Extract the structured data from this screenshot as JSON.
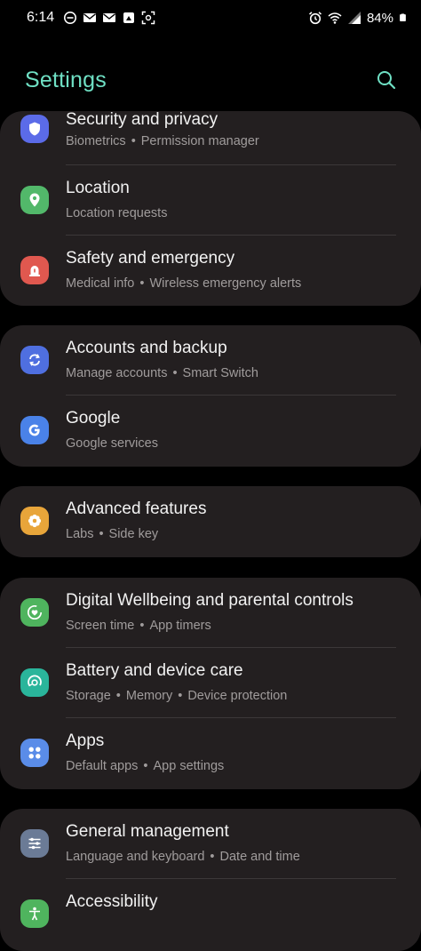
{
  "status_bar": {
    "time": "6:14",
    "battery": "84%"
  },
  "header": {
    "title": "Settings",
    "accent_color": "#6fe0c4"
  },
  "groups": [
    {
      "items": [
        {
          "title": "Security and privacy",
          "subtitle_parts": [
            "Biometrics",
            "Permission manager"
          ],
          "icon": "shield-icon",
          "color": "#5b6be8"
        },
        {
          "title": "Location",
          "subtitle_parts": [
            "Location requests"
          ],
          "icon": "location-pin-icon",
          "color": "#52b86a"
        },
        {
          "title": "Safety and emergency",
          "subtitle_parts": [
            "Medical info",
            "Wireless emergency alerts"
          ],
          "icon": "siren-icon",
          "color": "#e0584f"
        }
      ]
    },
    {
      "items": [
        {
          "title": "Accounts and backup",
          "subtitle_parts": [
            "Manage accounts",
            "Smart Switch"
          ],
          "icon": "sync-icon",
          "color": "#4f6fe0"
        },
        {
          "title": "Google",
          "subtitle_parts": [
            "Google services"
          ],
          "icon": "google-icon",
          "color": "#4a82e8"
        }
      ]
    },
    {
      "items": [
        {
          "title": "Advanced features",
          "subtitle_parts": [
            "Labs",
            "Side key"
          ],
          "icon": "gear-flower-icon",
          "color": "#e8a53a"
        }
      ]
    },
    {
      "items": [
        {
          "title": "Digital Wellbeing and parental controls",
          "subtitle_parts": [
            "Screen time",
            "App timers"
          ],
          "icon": "wellbeing-heart-icon",
          "color": "#4fb45e"
        },
        {
          "title": "Battery and device care",
          "subtitle_parts": [
            "Storage",
            "Memory",
            "Device protection"
          ],
          "icon": "device-care-icon",
          "color": "#2ab59b"
        },
        {
          "title": "Apps",
          "subtitle_parts": [
            "Default apps",
            "App settings"
          ],
          "icon": "apps-grid-icon",
          "color": "#5a8ce8"
        }
      ]
    },
    {
      "items": [
        {
          "title": "General management",
          "subtitle_parts": [
            "Language and keyboard",
            "Date and time"
          ],
          "icon": "sliders-icon",
          "color": "#6b7b96"
        },
        {
          "title": "Accessibility",
          "subtitle_parts": [],
          "icon": "accessibility-icon",
          "color": "#4fb45e"
        }
      ]
    }
  ]
}
